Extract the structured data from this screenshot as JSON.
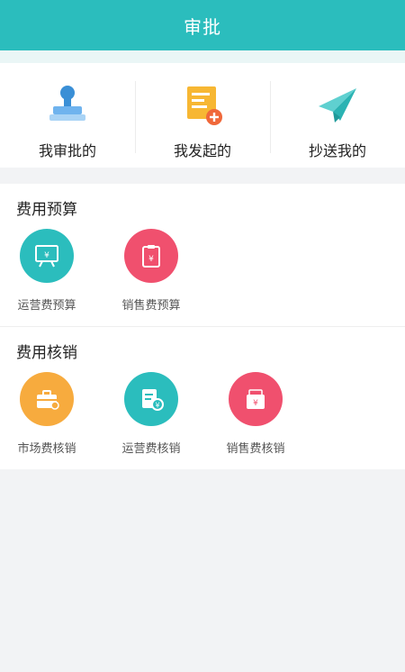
{
  "header": {
    "title": "审批"
  },
  "quick": [
    {
      "label": "我审批的",
      "icon": "stamp-icon"
    },
    {
      "label": "我发起的",
      "icon": "document-add-icon"
    },
    {
      "label": "抄送我的",
      "icon": "paper-plane-icon"
    }
  ],
  "sections": [
    {
      "title": "费用预算",
      "apps": [
        {
          "label": "运营费预算",
          "icon": "presentation-board-icon",
          "color": "#2bbdbd"
        },
        {
          "label": "销售费预算",
          "icon": "clipboard-calculator-icon",
          "color": "#f0506e"
        }
      ]
    },
    {
      "title": "费用核销",
      "apps": [
        {
          "label": "市场费核销",
          "icon": "briefcase-icon",
          "color": "#f7ab3e"
        },
        {
          "label": "运营费核销",
          "icon": "receipt-yuan-icon",
          "color": "#2bbdbd"
        },
        {
          "label": "销售费核销",
          "icon": "wallet-yuan-icon",
          "color": "#f0506e"
        }
      ]
    }
  ],
  "glyphs": {
    "yuan": "¥",
    "calc": "≑"
  }
}
